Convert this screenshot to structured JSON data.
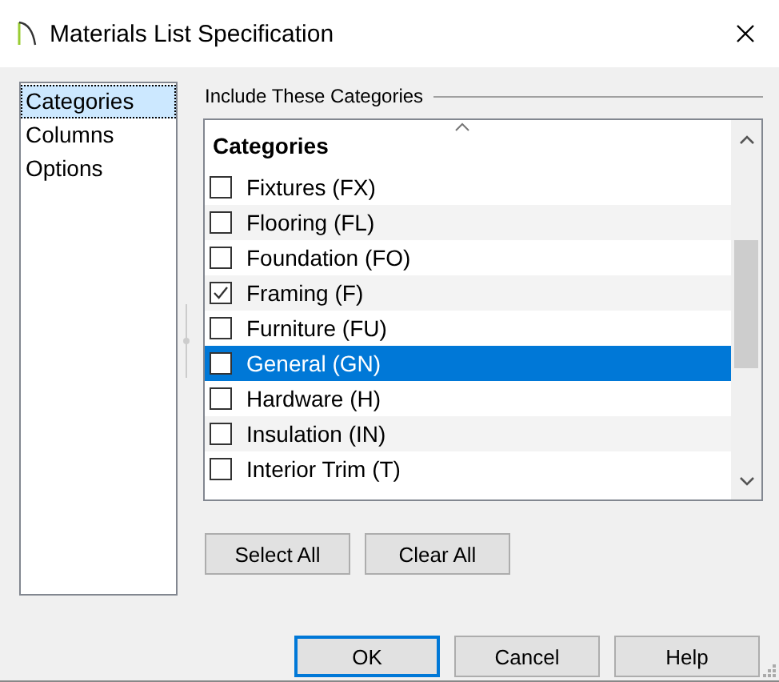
{
  "window": {
    "title": "Materials List Specification"
  },
  "sidebar": {
    "items": [
      {
        "label": "Categories",
        "selected": true
      },
      {
        "label": "Columns",
        "selected": false
      },
      {
        "label": "Options",
        "selected": false
      }
    ]
  },
  "group": {
    "title": "Include These Categories"
  },
  "list": {
    "header": "Categories",
    "rows": [
      {
        "label": "Fixtures (FX)",
        "checked": false,
        "selected": false
      },
      {
        "label": "Flooring (FL)",
        "checked": false,
        "selected": false
      },
      {
        "label": "Foundation (FO)",
        "checked": false,
        "selected": false
      },
      {
        "label": "Framing (F)",
        "checked": true,
        "selected": false
      },
      {
        "label": "Furniture (FU)",
        "checked": false,
        "selected": false
      },
      {
        "label": "General (GN)",
        "checked": false,
        "selected": true
      },
      {
        "label": "Hardware (H)",
        "checked": false,
        "selected": false
      },
      {
        "label": "Insulation (IN)",
        "checked": false,
        "selected": false
      },
      {
        "label": "Interior Trim (T)",
        "checked": false,
        "selected": false
      }
    ]
  },
  "list_buttons": [
    "Select All",
    "Clear All"
  ],
  "buttons": [
    {
      "label": "OK",
      "default": true
    },
    {
      "label": "Cancel",
      "default": false
    },
    {
      "label": "Help",
      "default": false
    }
  ]
}
